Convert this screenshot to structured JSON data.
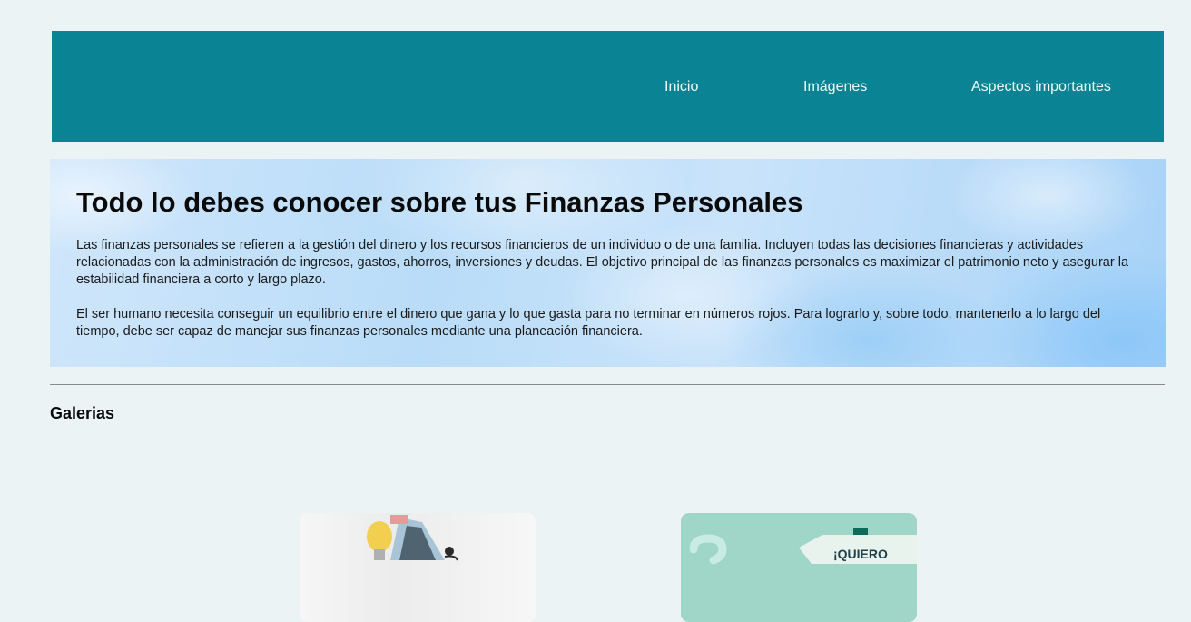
{
  "nav": {
    "items": [
      {
        "label": "Inicio"
      },
      {
        "label": "Imágenes"
      },
      {
        "label": "Aspectos importantes"
      }
    ]
  },
  "hero": {
    "title": "Todo lo debes conocer sobre tus Finanzas Personales",
    "paragraphs": [
      "Las finanzas personales se refieren a la gestión del dinero y los recursos financieros de un individuo o de una familia. Incluyen todas las decisiones financieras y actividades relacionadas con la administración de ingresos, gastos, ahorros, inversiones y deudas. El objetivo principal de las finanzas personales es maximizar el patrimonio neto y asegurar la estabilidad financiera a corto y largo plazo.",
      "El ser humano necesita conseguir un equilibrio entre el dinero que gana y lo que gasta para no terminar en números rojos. Para lograrlo y, sobre todo, mantenerlo a lo largo del tiempo, debe ser capaz de manejar sus finanzas personales mediante una planeación financiera."
    ]
  },
  "gallery": {
    "title": "Galerias",
    "cards": [
      {
        "caption_text": ""
      },
      {
        "sign_text": "¡QUIERO"
      }
    ]
  },
  "colors": {
    "nav_background": "#0a8394",
    "page_background": "#ebf3f5",
    "card_mint": "#9fd6c8"
  }
}
